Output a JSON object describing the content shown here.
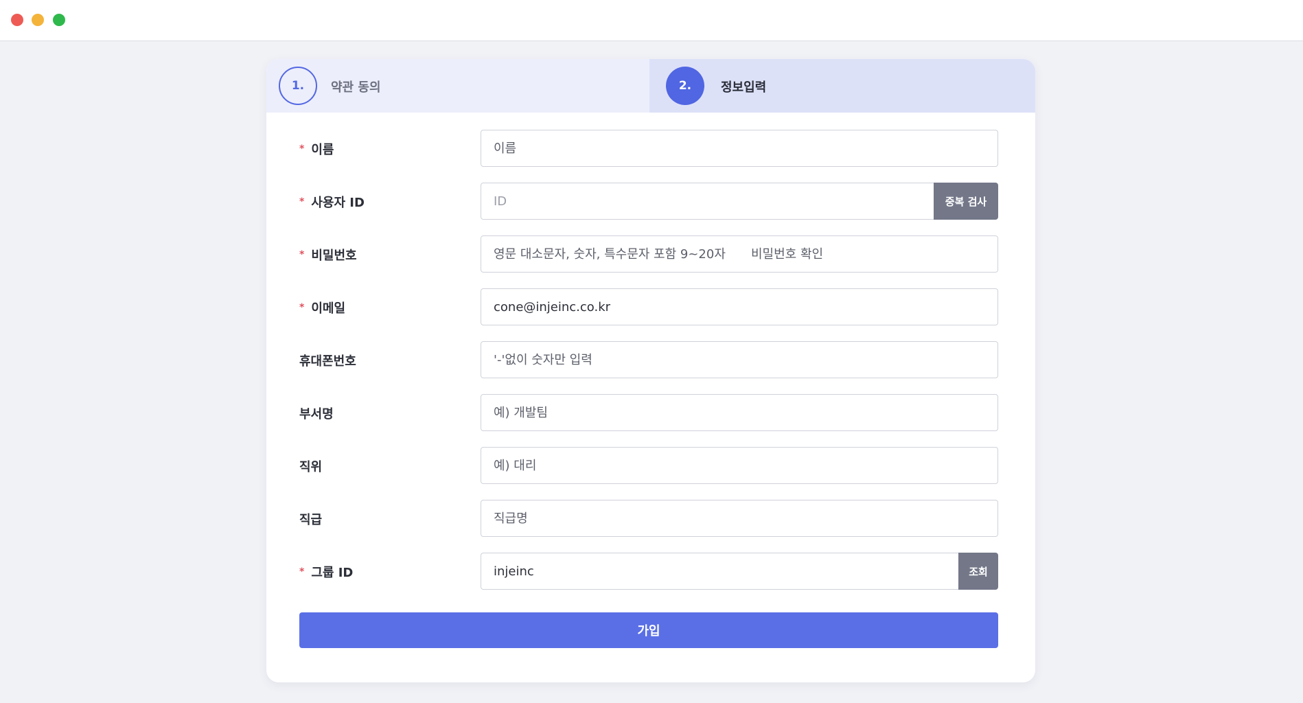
{
  "window": {
    "controls": [
      "close",
      "minimize",
      "maximize"
    ],
    "colors": {
      "close": "#ee5b55",
      "minimize": "#f4b33a",
      "maximize": "#2fb84c"
    }
  },
  "steps": [
    {
      "number": "1.",
      "label": "약관 동의",
      "active": false
    },
    {
      "number": "2.",
      "label": "정보입력",
      "active": true
    }
  ],
  "form": {
    "name": {
      "label": "이름",
      "required": true,
      "placeholder": "이름"
    },
    "user_id": {
      "label": "사용자 ID",
      "required": true,
      "placeholder": "ID",
      "button": "중복 검사"
    },
    "password": {
      "label": "비밀번호",
      "required": true,
      "placeholder": "영문 대소문자, 숫자, 특수문자 포함 9~20자",
      "confirm_placeholder": "비밀번호 확인"
    },
    "email": {
      "label": "이메일",
      "required": true,
      "value": "cone@injeinc.co.kr"
    },
    "phone": {
      "label": "휴대폰번호",
      "required": false,
      "placeholder": "'-'없이 숫자만 입력"
    },
    "department": {
      "label": "부서명",
      "required": false,
      "placeholder": "예) 개발팀"
    },
    "position": {
      "label": "직위",
      "required": false,
      "placeholder": "예) 대리"
    },
    "grade": {
      "label": "직급",
      "required": false,
      "placeholder": "직급명"
    },
    "group_id": {
      "label": "그룹 ID",
      "required": true,
      "value": "injeinc",
      "button": "조회"
    },
    "required_mark": "*",
    "submit_label": "가입"
  },
  "colors": {
    "accent": "#5a6fe6",
    "step_active": "#5066e2",
    "side_button": "#737788",
    "required": "#e0525e"
  }
}
